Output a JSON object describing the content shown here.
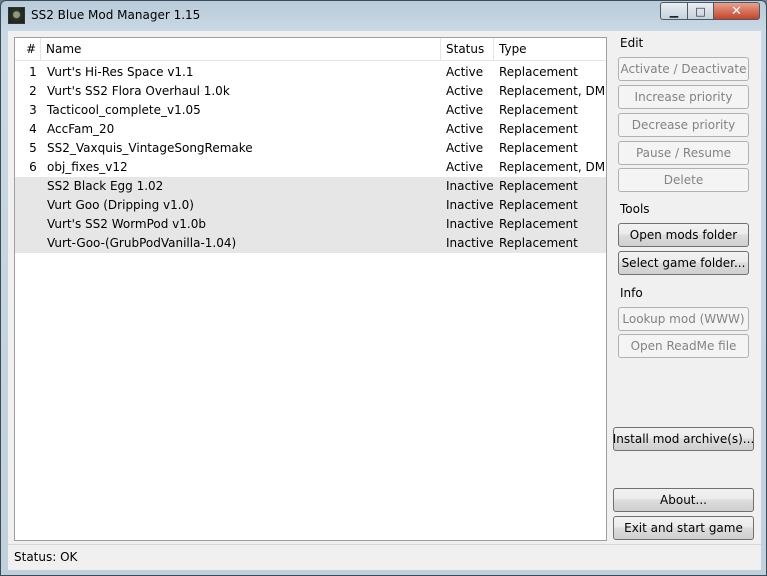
{
  "window": {
    "title": "SS2 Blue Mod Manager 1.15",
    "minimize": "▁",
    "maximize": "□",
    "close": "✕"
  },
  "mods": {
    "headers": {
      "num": "#",
      "name": "Name",
      "status": "Status",
      "type": "Type"
    },
    "rows": [
      {
        "num": "1",
        "name": "Vurt's Hi-Res Space v1.1",
        "status": "Active",
        "type": "Replacement"
      },
      {
        "num": "2",
        "name": "Vurt's SS2 Flora Overhaul 1.0k",
        "status": "Active",
        "type": "Replacement, DML"
      },
      {
        "num": "3",
        "name": "Tacticool_complete_v1.05",
        "status": "Active",
        "type": "Replacement"
      },
      {
        "num": "4",
        "name": "AccFam_20",
        "status": "Active",
        "type": "Replacement"
      },
      {
        "num": "5",
        "name": "SS2_Vaxquis_VintageSongRemake",
        "status": "Active",
        "type": "Replacement"
      },
      {
        "num": "6",
        "name": "obj_fixes_v12",
        "status": "Active",
        "type": "Replacement, DML"
      },
      {
        "num": "",
        "name": "SS2 Black Egg 1.02",
        "status": "Inactive",
        "type": "Replacement"
      },
      {
        "num": "",
        "name": "Vurt Goo (Dripping v1.0)",
        "status": "Inactive",
        "type": "Replacement"
      },
      {
        "num": "",
        "name": "Vurt's SS2 WormPod v1.0b",
        "status": "Inactive",
        "type": "Replacement"
      },
      {
        "num": "",
        "name": "Vurt-Goo-(GrubPodVanilla-1.04)",
        "status": "Inactive",
        "type": "Replacement"
      }
    ]
  },
  "edit": {
    "label": "Edit",
    "activate": "Activate / Deactivate",
    "increase": "Increase priority",
    "decrease": "Decrease priority",
    "pause": "Pause / Resume",
    "delete": "Delete"
  },
  "tools": {
    "label": "Tools",
    "open_mods": "Open mods folder",
    "select_game": "Select game folder..."
  },
  "info": {
    "label": "Info",
    "lookup": "Lookup mod (WWW)",
    "readme": "Open ReadMe file"
  },
  "actions": {
    "install": "Install mod archive(s)...",
    "about": "About...",
    "exit": "Exit and start game"
  },
  "status_bar": {
    "text": "Status: OK"
  }
}
